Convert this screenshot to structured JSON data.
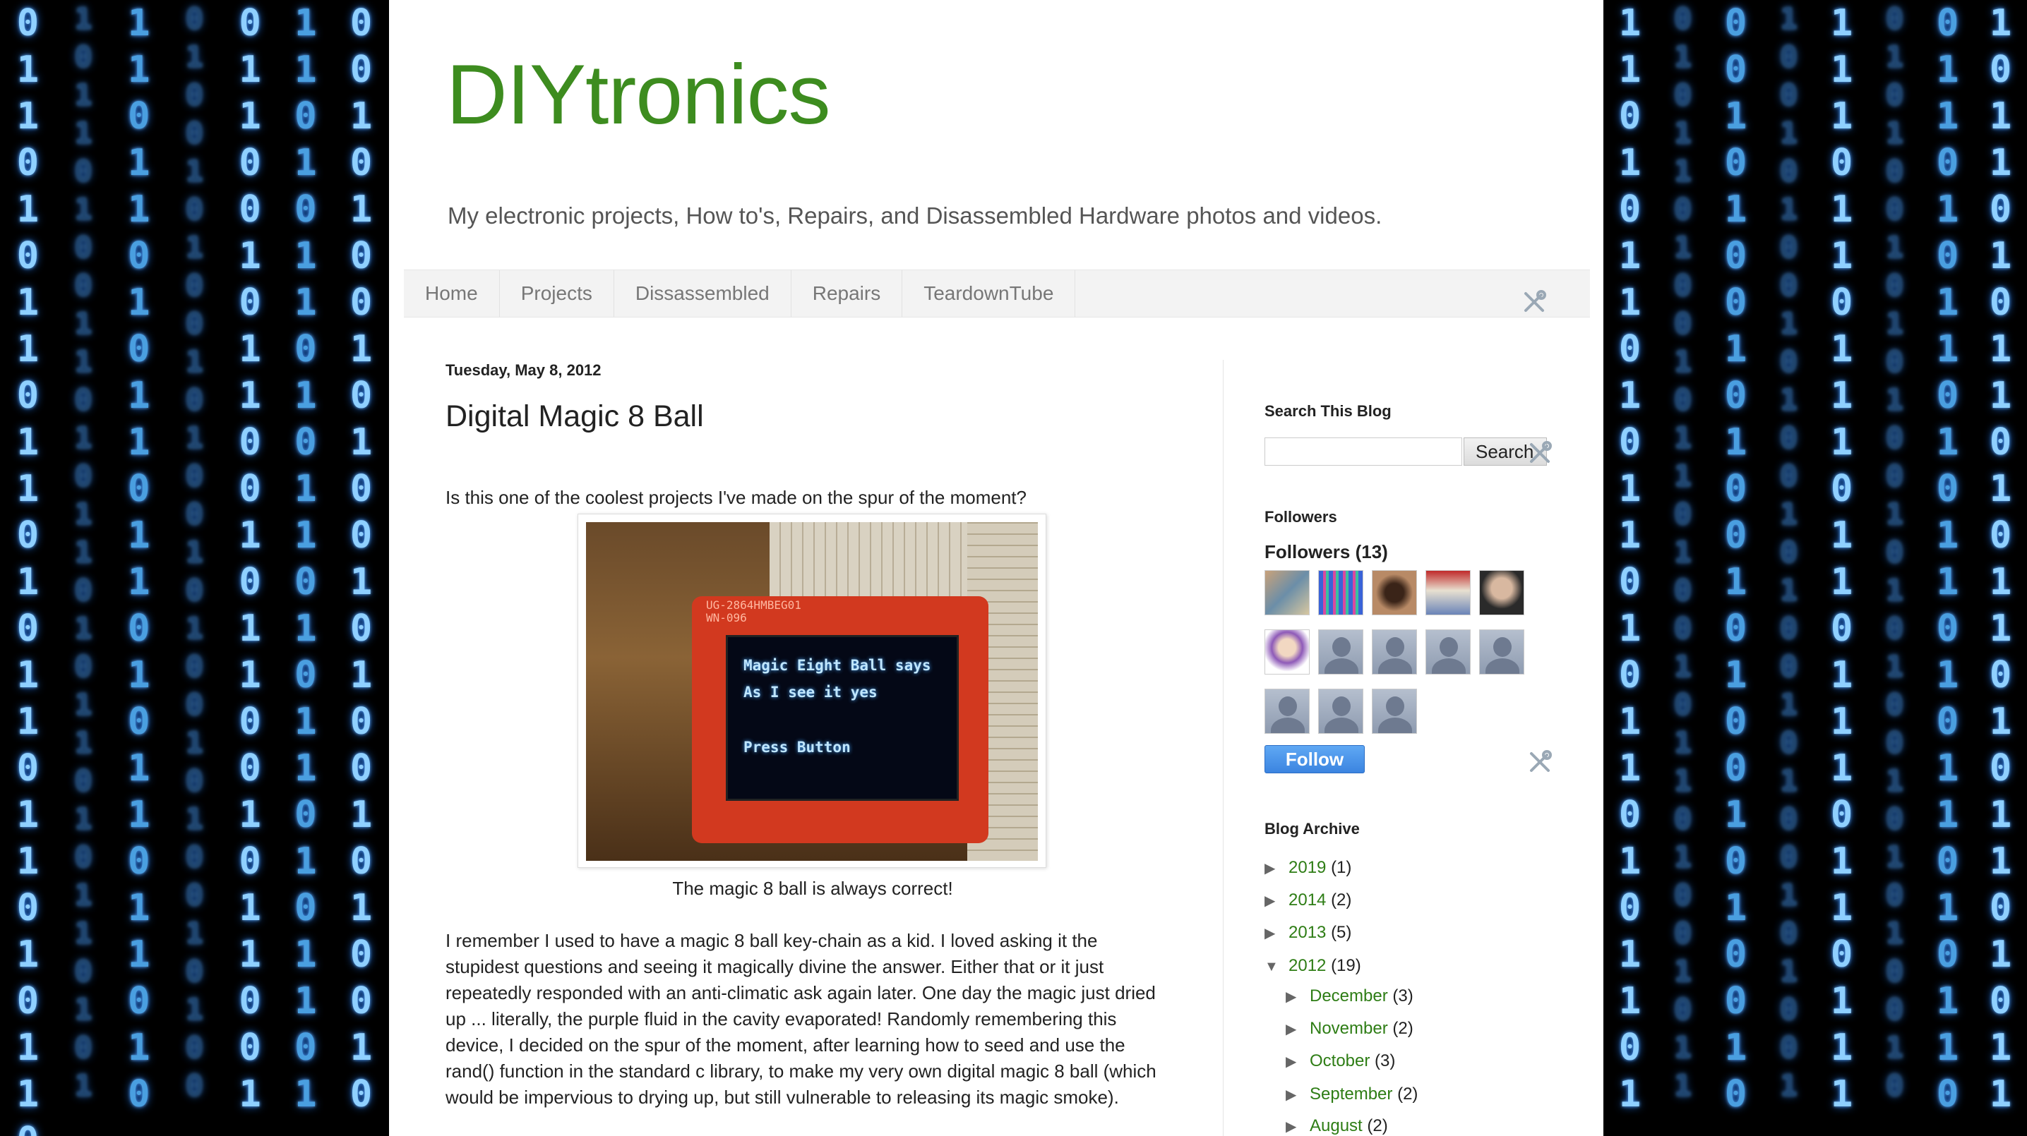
{
  "blog": {
    "title": "DIYtronics",
    "description": "My electronic projects, How to's, Repairs, and Disassembled Hardware photos and videos."
  },
  "colors": {
    "title_green": "#3d8c1f",
    "link_green": "#2e7d15",
    "matrix_blue": "#4a9fe0",
    "follow_blue": "#4a96ea"
  },
  "tabs": [
    "Home",
    "Projects",
    "Dissassembled",
    "Repairs",
    "TeardownTube"
  ],
  "post": {
    "date": "Tuesday, May 8, 2012",
    "title": "Digital Magic 8 Ball",
    "intro": "Is this one of the coolest projects I've made on the spur of the moment?",
    "photo": {
      "pcb_label_line1": "UG-2864HMBEG01",
      "pcb_label_line2": "WN-096",
      "screen_line1": "Magic Eight Ball says",
      "screen_line2": "As I see it yes",
      "screen_line3": "Press Button"
    },
    "caption": "The magic 8 ball is always correct!",
    "body": "I remember I used to have a magic 8 ball key-chain as a kid. I loved asking it the stupidest questions and seeing it magically divine the answer. Either that or it just repeatedly responded with an anti-climatic ask again later. One day the magic just dried up ... literally, the purple fluid in the cavity evaporated! Randomly remembering this device, I decided on the spur of the moment, after learning how to seed and use the rand() function in the standard c library, to make my very own digital magic 8 ball (which would be impervious to drying up, but still vulnerable to releasing its magic smoke)."
  },
  "sidebar": {
    "search_heading": "Search This Blog",
    "search_button": "Search",
    "followers_heading": "Followers",
    "followers_count": "Followers (13)",
    "follow_button": "Follow",
    "archive_heading": "Blog Archive",
    "archive": [
      {
        "year": "2019",
        "count": "(1)",
        "expanded": false
      },
      {
        "year": "2014",
        "count": "(2)",
        "expanded": false
      },
      {
        "year": "2013",
        "count": "(5)",
        "expanded": false
      },
      {
        "year": "2012",
        "count": "(19)",
        "expanded": true
      }
    ],
    "months": [
      {
        "month": "December",
        "count": "(3)"
      },
      {
        "month": "November",
        "count": "(2)"
      },
      {
        "month": "October",
        "count": "(3)"
      },
      {
        "month": "September",
        "count": "(2)"
      },
      {
        "month": "August",
        "count": "(2)"
      }
    ]
  },
  "icons": {
    "tool": "wrench-screwdriver-icon",
    "collapsed": "triangle-right-icon",
    "expanded": "triangle-down-icon"
  }
}
